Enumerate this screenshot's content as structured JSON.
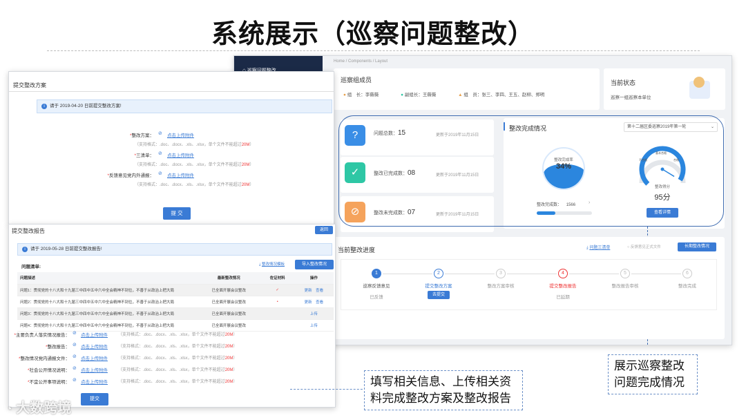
{
  "slide": {
    "title": "系统展示（巡察问题整改）"
  },
  "sidebar": {
    "item": "巡察问题整改"
  },
  "breadcrumb": {
    "text": "Home / Components / Layout"
  },
  "team": {
    "title": "巡察组成员",
    "leader_label": "组　长：",
    "leader": "李薇薇",
    "deputy_label": "副组长：",
    "deputy": "王薇薇",
    "members_label": "组　员：",
    "members": "张三、李四、王五、赵柳、郑明"
  },
  "status": {
    "title": "当前状态",
    "text": "巡察一组巡察本单位"
  },
  "stats": [
    {
      "label": "问题总数：",
      "value": "15",
      "updated": "更新于2019年11月15日",
      "color": "#3a8ee6",
      "icon": "question-icon",
      "glyph": "?"
    },
    {
      "label": "整改已完成数：",
      "value": "08",
      "updated": "更新于2019年11月15日",
      "color": "#2ec7a5",
      "icon": "doc-check-icon",
      "glyph": "✓"
    },
    {
      "label": "整改未完成数：",
      "value": "07",
      "updated": "更新于2019年11月15日",
      "color": "#f5a35c",
      "icon": "doc-pending-icon",
      "glyph": "⊘"
    }
  ],
  "completion": {
    "title": "整改完成情况",
    "select": "第十二届区委巡察2019年第一轮",
    "rate_label": "整改完成率",
    "rate": "34%",
    "rate_value": 0.34,
    "done_label": "整改完成数：",
    "done_value": "1566",
    "score_label": "整改得分",
    "score": "95分",
    "score_value": 0.95,
    "gauge_labels": [
      "不合格",
      "基本合格",
      "合格"
    ],
    "detail_button": "查看详情"
  },
  "progress": {
    "title": "当前整改进度",
    "download": "问题三清单",
    "checkbox": "反馈意见正式文件",
    "long_button": "长期整改情况",
    "steps": [
      {
        "n": "1",
        "label": "巡察反馈意见",
        "sub": "已反馈"
      },
      {
        "n": "2",
        "label": "提交整改方案",
        "sub": "去提交"
      },
      {
        "n": "3",
        "label": "整改方案审核",
        "sub": ""
      },
      {
        "n": "4",
        "label": "提交整改报告",
        "sub": "已延期"
      },
      {
        "n": "5",
        "label": "整改报告审核",
        "sub": ""
      },
      {
        "n": "6",
        "label": "整改完成",
        "sub": ""
      }
    ]
  },
  "plan_form": {
    "title": "提交整改方案",
    "notice": "请于 2019-04-20 日前提交整改方案!",
    "fields": [
      {
        "label": "整改方案：",
        "link": "点击上传附件",
        "hint": "（支持格式：.doc、.docx、.xls、.xlsx，单个文件不能超过",
        "limit": "20M",
        "end": "）"
      },
      {
        "label": "三清单：",
        "link": "点击上传附件",
        "hint": "（支持格式：.doc、.docx、.xls、.xlsx，单个文件不能超过",
        "limit": "20M",
        "end": "）"
      },
      {
        "label": "反馈意见党内外通报：",
        "link": "点击上传附件",
        "hint": "（支持格式：.doc、.docx、.xls、.xlsx，单个文件不能超过",
        "limit": "20M",
        "end": "）"
      }
    ],
    "submit": "提 交"
  },
  "report_form": {
    "title": "提交整改报告",
    "return": "返回",
    "notice": "请于 2019-05-28 日前提交整改报告!",
    "list_label": "问题清单:",
    "download": "整改情况模板",
    "import_button": "导入整改情况",
    "columns": [
      "问题描述",
      "最新整改情况",
      "佐证材料",
      "操作"
    ],
    "rows": [
      {
        "desc": "问题1：贯彻党的十八大和十九届三中四中五中六中全会精神不到位，不善于从政治上把大局",
        "status": "已全面开展会议整改",
        "proof": "✓",
        "ops": "更新　查看"
      },
      {
        "desc": "问题2：贯彻党的十八大和十九届三中四中五中六中全会精神不到位，不善于从政治上把大局",
        "status": "已全面开展会议整改",
        "proof": "•",
        "ops": "更新　查看"
      },
      {
        "desc": "问题3：贯彻党的十八大和十九届三中四中五中六中全会精神不到位，不善于从政治上把大局",
        "status": "已全面开展会议整改",
        "proof": "",
        "ops": "上传"
      },
      {
        "desc": "问题4：贯彻党的十八大和十九届三中四中五中六中全会精神不到位，不善于从政治上把大局",
        "status": "已全面开展会议整改",
        "proof": "",
        "ops": "上传"
      }
    ],
    "fields": [
      {
        "label": "主要负责人落实情况报告：",
        "link": "点击上传附件",
        "hint": "（支持格式：.doc、.docx、.xls、.xlsx，单个文件不能超过",
        "limit": "20M",
        "end": "）"
      },
      {
        "label": "整改报告：",
        "link": "点击上传附件",
        "hint": "（支持格式：.doc、.docx、.xls、.xlsx，单个文件不能超过",
        "limit": "20M",
        "end": "）"
      },
      {
        "label": "整改情况党内通报文件：",
        "link": "点击上传附件",
        "hint": "（支持格式：.doc、.docx、.xls、.xlsx，单个文件不能超过",
        "limit": "20M",
        "end": "）"
      },
      {
        "label": "社会公开情况说明：",
        "link": "点击上传附件",
        "hint": "（支持格式：.doc、.docx、.xls、.xlsx，单个文件不能超过",
        "limit": "20M",
        "end": "）"
      },
      {
        "label": "不宜公开事项说明：",
        "link": "点击上传附件",
        "hint": "（支持格式：.doc、.docx、.xls、.xlsx，单个文件不能超过",
        "limit": "20M",
        "end": "）"
      }
    ],
    "submit": "提交"
  },
  "callouts": {
    "right": "展示巡察整改\n问题完成情况",
    "left": "填写相关信息、上传相关资\n料完成整改方案及整改报告"
  },
  "watermark": "大数跨境"
}
